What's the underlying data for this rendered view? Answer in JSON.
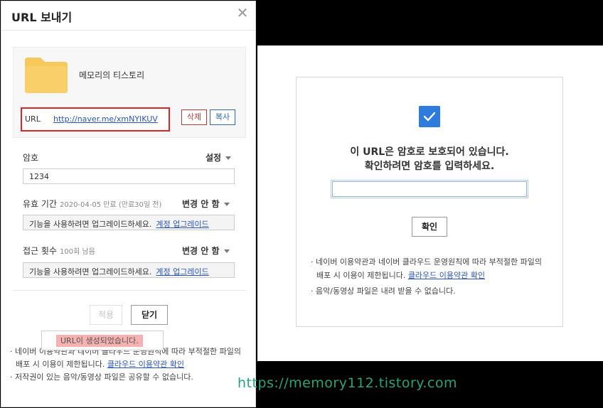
{
  "dialog": {
    "title": "URL 보내기",
    "close_symbol": "✕",
    "file": {
      "name": "메모리의 티스토리",
      "url_label": "URL",
      "url": "http://naver.me/xmNYIKUV",
      "delete_label": "삭제",
      "copy_label": "복사"
    },
    "password": {
      "label": "암호",
      "setting_label": "설정",
      "value": "1234"
    },
    "expiry": {
      "label": "유효 기간",
      "detail": "2020-04-05 만료 (만료30일 전)",
      "change_label": "변경 안 함",
      "upgrade_text": "기능을 사용하려면 업그레이드하세요.",
      "upgrade_link": "계정 업그레이드"
    },
    "access_count": {
      "label": "접근 횟수",
      "detail": "100회 남음",
      "change_label": "변경 안 함",
      "upgrade_text": "기능을 사용하려면 업그레이드하세요.",
      "upgrade_link": "계정 업그레이드"
    },
    "apply_label": "적용",
    "close_label": "닫기",
    "toast": "URL이 생성되었습니다.",
    "notes": [
      {
        "text": "네이버 이용약관과 네이버 클라우드 운영원칙에 따라 부적절한 파일의 배포 시 이용이 제한됩니다. ",
        "link": "클라우드 이용약관 확인"
      },
      {
        "text": "저작권이 있는 음악/동영상 파일은 공유할 수 없습니다.",
        "link": ""
      }
    ]
  },
  "password_panel": {
    "message_line1": "이 URL은 암호로 보호되어 있습니다.",
    "message_line2": "확인하려면 암호를 입력하세요.",
    "confirm_label": "확인",
    "notes": [
      {
        "text": "네이버 이용약관과 네이버 클라우드 운영원칙에 따라 부적절한 파일의 배포 시 이용이 제한됩니다. ",
        "link": "클라우드 이용약관 확인"
      },
      {
        "text": "음악/동영상 파일은 내려 받을 수 없습니다.",
        "link": ""
      }
    ]
  },
  "watermark": "https://memory112.tistory.com",
  "colors": {
    "accent_blue": "#2d7bdc",
    "delete_red": "#b23b3b",
    "highlight_red": "#d9262c",
    "folder_yellow": "#f7c95d",
    "watermark_green": "#2aa37a"
  }
}
